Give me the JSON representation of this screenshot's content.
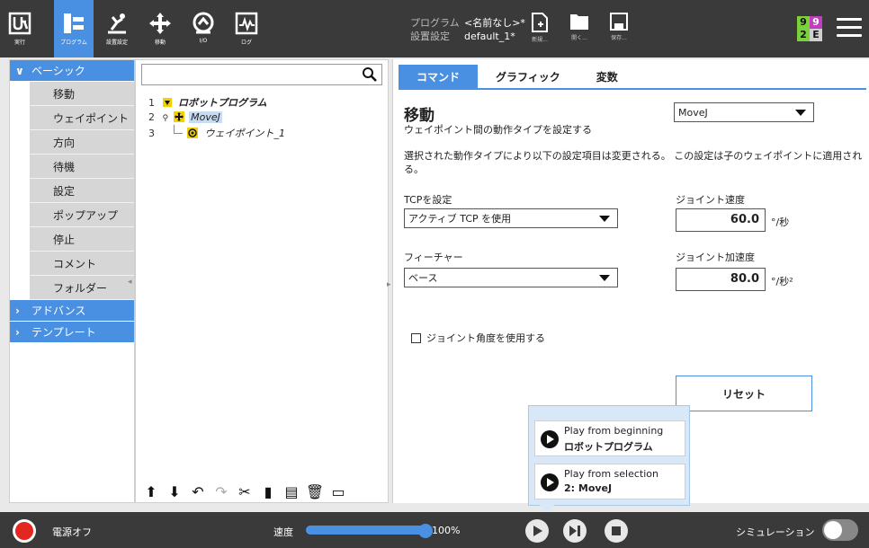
{
  "header": {
    "nav_buttons": [
      {
        "label": "実行",
        "icon": "ur-logo-icon"
      },
      {
        "label": "プログラム",
        "icon": "program-icon",
        "active": true
      },
      {
        "label": "設置設定",
        "icon": "installation-icon"
      },
      {
        "label": "移動",
        "icon": "move-icon"
      },
      {
        "label": "I/O",
        "icon": "io-icon"
      },
      {
        "label": "ログ",
        "icon": "log-icon"
      }
    ],
    "program_key": "プログラム",
    "program_value": "<名前なし>*",
    "install_key": "設置設定",
    "install_value": "default_1*",
    "file_buttons": [
      {
        "label": "新規...",
        "icon": "new-file-icon"
      },
      {
        "label": "開く...",
        "icon": "open-folder-icon"
      },
      {
        "label": "保存...",
        "icon": "save-icon"
      }
    ],
    "status_grid": [
      "9",
      "9",
      "2",
      "E"
    ],
    "colors": {
      "bar": "#3a3a3a",
      "accent": "#4a90e2",
      "green": "#7bd13a",
      "magenta": "#c03fbf"
    }
  },
  "leftnav": {
    "basic_header": "ベーシック",
    "basic_items": [
      "移動",
      "ウェイポイント",
      "方向",
      "待機",
      "設定",
      "ポップアップ",
      "停止",
      "コメント",
      "フォルダー"
    ],
    "advanced_header": "アドバンス",
    "template_header": "テンプレート"
  },
  "tree": {
    "search_placeholder": "",
    "nodes": [
      {
        "num": "1",
        "label": "ロボットプログラム"
      },
      {
        "num": "2",
        "label": "MoveJ"
      },
      {
        "num": "3",
        "label": "ウェイポイント_1"
      }
    ]
  },
  "tabs": [
    "コマンド",
    "グラフィック",
    "変数"
  ],
  "command": {
    "title": "移動",
    "subtitle": "ウェイポイント間の動作タイプを設定する",
    "move_type": "MoveJ",
    "description": "選択された動作タイプにより以下の設定項目は変更される。 この設定は子のウェイポイントに適用される。",
    "tcp_label": "TCPを設定",
    "tcp_value": "アクティブ TCP を使用",
    "feature_label": "フィーチャー",
    "feature_value": "ベース",
    "joint_speed_label": "ジョイント速度",
    "joint_speed_value": "60.0",
    "joint_speed_unit": "°/秒",
    "joint_accel_label": "ジョイント加速度",
    "joint_accel_value": "80.0",
    "joint_accel_unit": "°/秒²",
    "joint_angle_checkbox": "ジョイント角度を使用する",
    "reset_label": "リセット"
  },
  "play_popup": {
    "from_beginning": "Play from beginning",
    "from_beginning_target": "ロボットプログラム",
    "from_selection": "Play from selection",
    "from_selection_target": "2: MoveJ"
  },
  "footer": {
    "power_label": "電源オフ",
    "speed_label": "速度",
    "speed_percent": 100,
    "speed_value": "100%",
    "simulation_label": "シミュレーション",
    "simulation_on": false
  }
}
